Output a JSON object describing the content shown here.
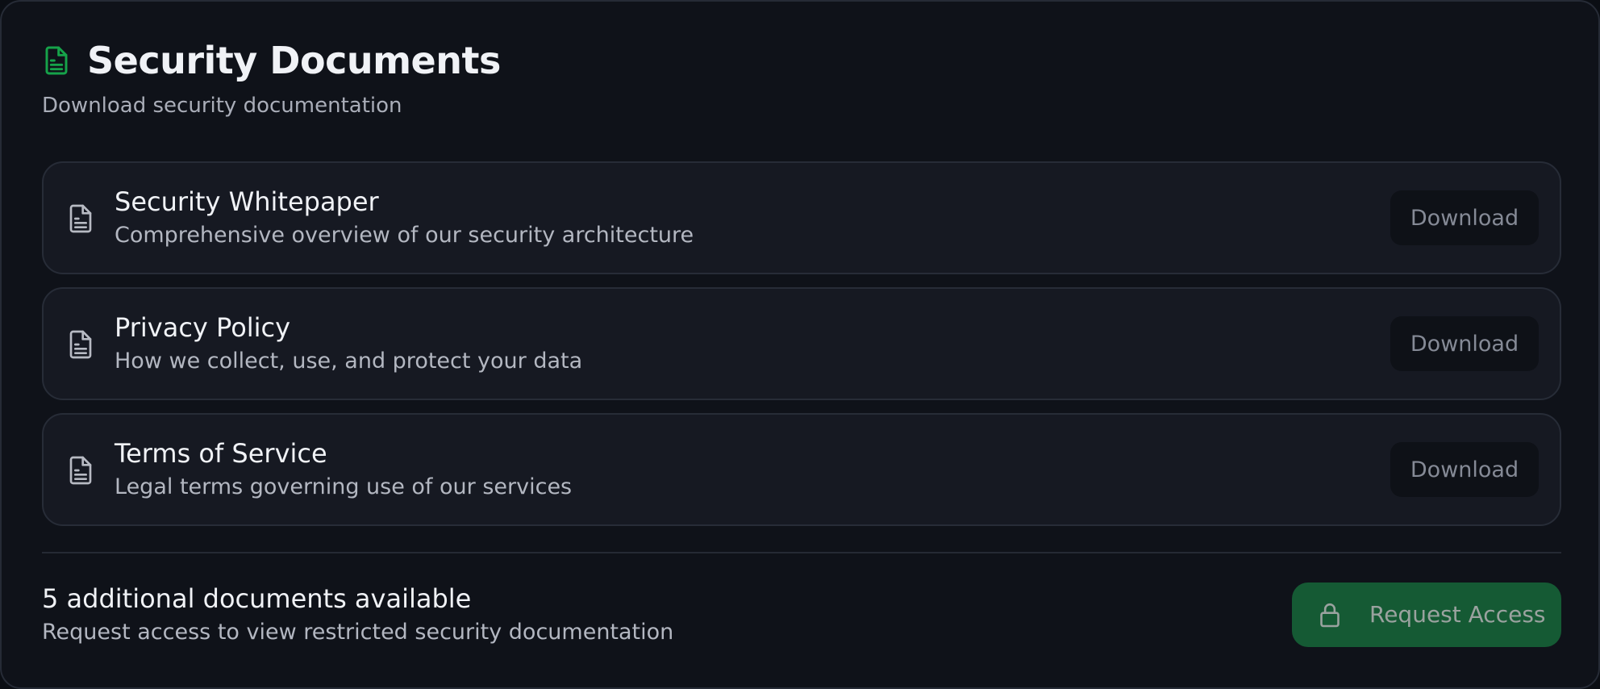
{
  "header": {
    "title": "Security Documents",
    "subtitle": "Download security documentation",
    "icon": "file-text-icon"
  },
  "documents": [
    {
      "name": "Security Whitepaper",
      "description": "Comprehensive overview of our security architecture",
      "action_label": "Download",
      "icon": "file-text-icon"
    },
    {
      "name": "Privacy Policy",
      "description": "How we collect, use, and protect your data",
      "action_label": "Download",
      "icon": "file-text-icon"
    },
    {
      "name": "Terms of Service",
      "description": "Legal terms governing use of our services",
      "action_label": "Download",
      "icon": "file-text-icon"
    }
  ],
  "footer": {
    "title": "5 additional documents available",
    "description": "Request access to view restricted security documentation",
    "button_label": "Request Access",
    "button_icon": "lock-icon"
  },
  "colors": {
    "background": "#0f1219",
    "item_background": "#161922",
    "accent_green": "#16a34a",
    "request_button": "#155a34"
  }
}
